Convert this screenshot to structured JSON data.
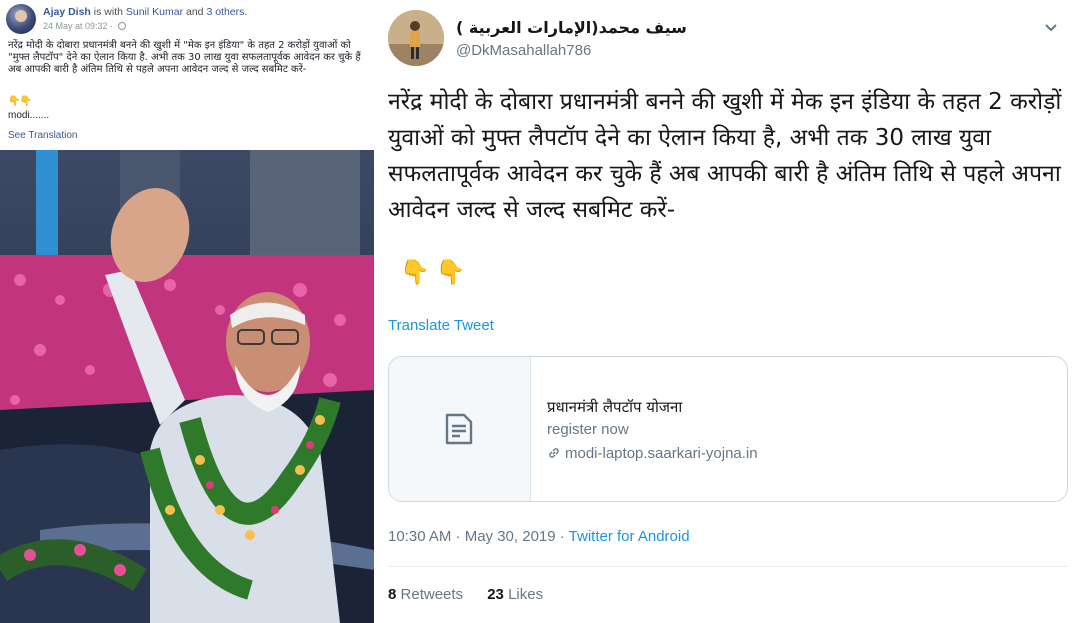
{
  "facebook": {
    "author": "Ajay Dish",
    "with_text": " is with ",
    "tagged": "Sunil Kumar",
    "and_text": " and ",
    "others": "3 others.",
    "timestamp": "24 May at 09:32 · ",
    "post_text": "नरेंद्र मोदी के दोबारा प्रधानमंत्री बनने की खुशी में \"मेक इन इंडिया\" के तहत 2 करोड़ों युवाओं को \"मुफ्त लैपटॉप\" देने का ऐलान किया है. अभी तक 30 लाख युवा सफलतापूर्वक आवेदन कर चुके हैं अब आपकी बारी है अंतिम तिथि से पहले अपना आवेदन जल्द से जल्द सबमिट करें-",
    "emoji": "👇👇",
    "more": "modi.......",
    "see_translation": "See Translation"
  },
  "twitter": {
    "display_name": "( الإمارات العربية)سيف محمد",
    "handle": "@DkMasahallah786",
    "tweet_text": "नरेंद्र मोदी के दोबारा प्रधानमंत्री बनने की खुशी में मेक इन इंडिया के तहत 2 करोड़ों युवाओं को मुफ्त लैपटॉप देने का ऐलान किया है, अभी तक 30 लाख युवा सफलतापूर्वक आवेदन कर चुके हैं अब आपकी बारी है अंतिम तिथि से पहले अपना आवेदन जल्द से जल्द सबमिट करें-",
    "emoji": "👇👇",
    "translate_label": "Translate Tweet",
    "card": {
      "title": "प्रधानमंत्री लैपटॉप योजना",
      "description": "register now",
      "url": "modi-laptop.saarkari-yojna.in"
    },
    "timestamp": "10:30 AM · May 30, 2019 · ",
    "source": "Twitter for Android",
    "retweets_count": "8",
    "retweets_label": "Retweets",
    "likes_count": "23",
    "likes_label": "Likes"
  },
  "colors": {
    "fb_link": "#385898",
    "tw_link": "#1b95e0",
    "tw_secondary": "#657786"
  }
}
